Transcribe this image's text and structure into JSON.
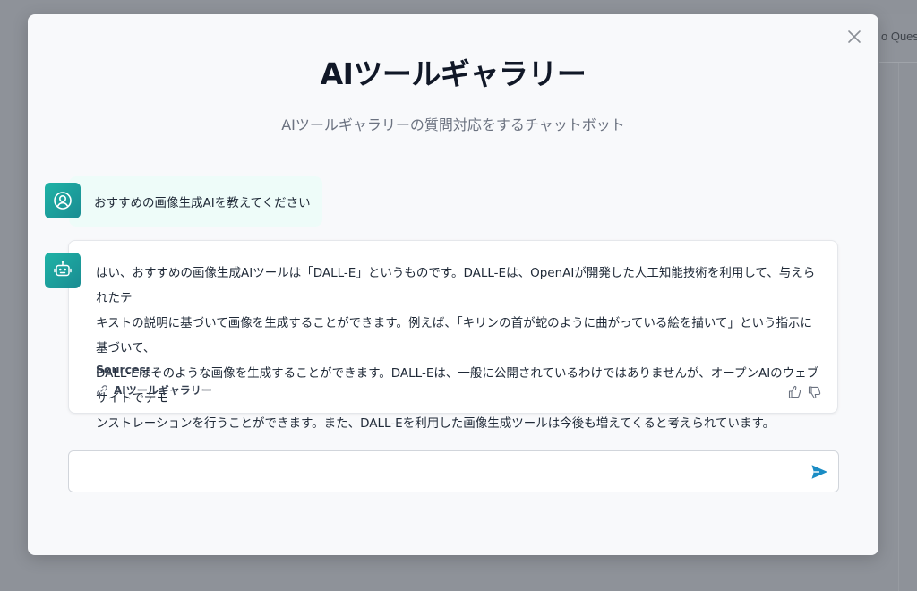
{
  "background": {
    "partial_text": "o Quest"
  },
  "modal": {
    "title": "AIツールギャラリー",
    "subtitle": "AIツールギャラリーの質問対応をするチャットボット",
    "close_icon": "close-icon"
  },
  "messages": {
    "user": {
      "text": "おすすめの画像生成AIを教えてください",
      "avatar_icon": "user-icon"
    },
    "bot": {
      "avatar_icon": "robot-icon",
      "lines": [
        "はい、おすすめの画像生成AIツールは「DALL-E」というものです。DALL-Eは、OpenAIが開発した人工知能技術を利用して、与えられたテ",
        "キストの説明に基づいて画像を生成することができます。例えば、「キリンの首が蛇のように曲がっている絵を描いて」という指示に基づいて、",
        "DALL-Eはそのような画像を生成することができます。DALL-Eは、一般に公開されているわけではありませんが、オープンAIのウェブサイトでデモ",
        "ンストレーションを行うことができます。また、DALL-Eを利用した画像生成ツールは今後も増えてくると考えられています。"
      ],
      "sources_label": "Sources:",
      "source_link": "AIツールギャラリー",
      "feedback_icons": [
        "thumbs-up-icon",
        "thumbs-down-icon"
      ]
    }
  },
  "input": {
    "value": "",
    "placeholder": "",
    "send_icon": "send-icon"
  },
  "colors": {
    "accent": "#1fa5a0",
    "send": "#1a8cc4",
    "user_bubble": "#eefcf9",
    "modal_bg": "#f8f9fb",
    "overlay": "#8e9299"
  }
}
